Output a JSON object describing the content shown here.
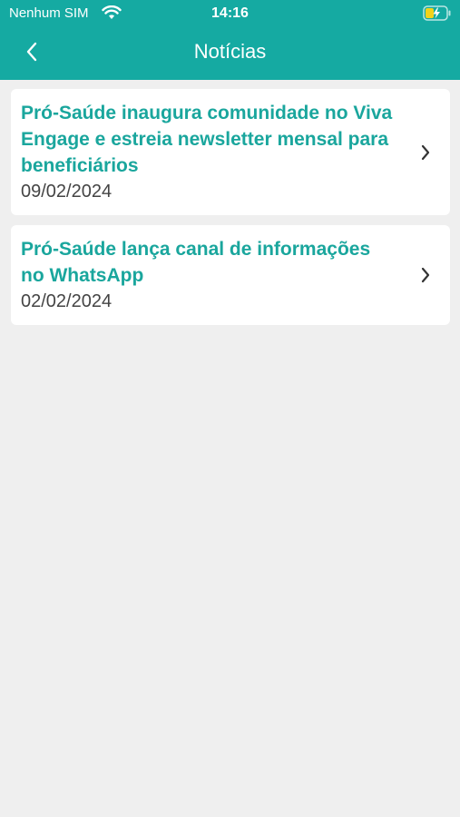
{
  "status_bar": {
    "carrier": "Nenhum SIM",
    "time": "14:16"
  },
  "nav": {
    "title": "Notícias",
    "back_icon": "chevron-left-icon"
  },
  "news": [
    {
      "title": "Pró-Saúde inaugura comunidade no Viva Engage e estreia newsletter mensal para beneficiários",
      "date": "09/02/2024"
    },
    {
      "title": "Pró-Saúde lança canal de informações no WhatsApp",
      "date": "02/02/2024"
    }
  ],
  "colors": {
    "brand": "#15aaa2",
    "title_text": "#1aa69d",
    "background": "#efefef"
  }
}
